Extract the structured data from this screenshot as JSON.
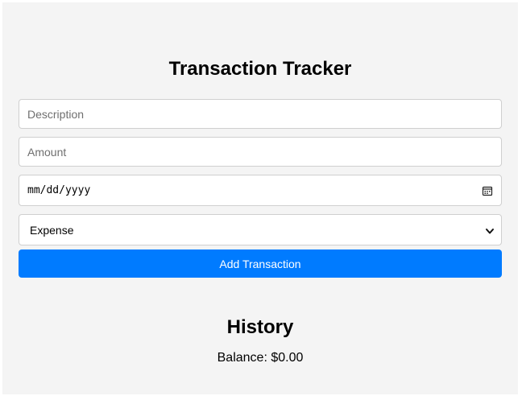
{
  "header": {
    "title": "Transaction Tracker"
  },
  "form": {
    "description_placeholder": "Description",
    "description_value": "",
    "amount_placeholder": "Amount",
    "amount_value": "",
    "date_placeholder": "mm/dd/yyyy",
    "date_icon": "calendar-icon",
    "type_selected": "Expense",
    "type_icon": "chevron-down-icon",
    "submit_label": "Add Transaction"
  },
  "history": {
    "title": "History",
    "balance_text": "Balance: $0.00"
  },
  "colors": {
    "panel_background": "#f4f4f4",
    "button_background": "#007bff",
    "button_text": "#ffffff"
  }
}
